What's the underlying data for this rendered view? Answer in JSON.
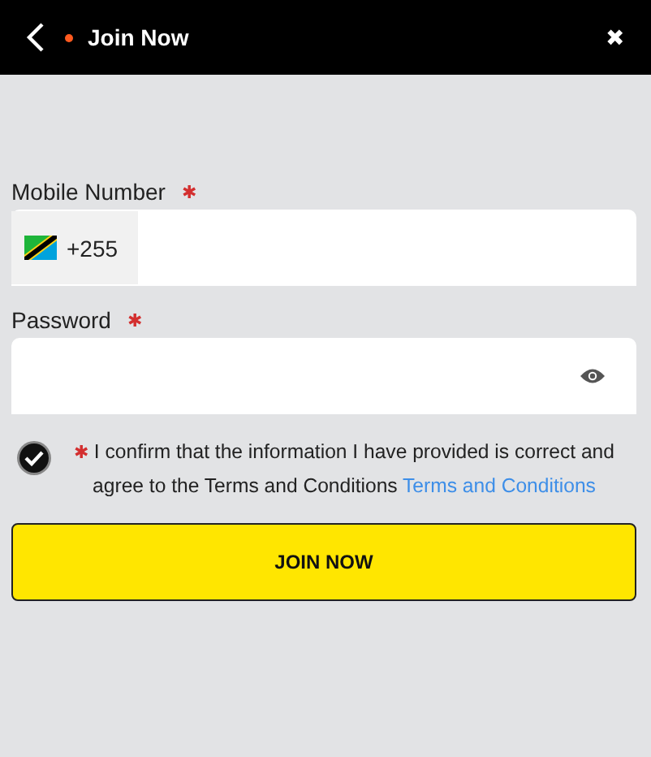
{
  "header": {
    "title": "Join Now",
    "close": "✖"
  },
  "mobile": {
    "label": "Mobile Number",
    "required_mark": "✱",
    "country_code": "+255"
  },
  "password": {
    "label": "Password",
    "required_mark": "✱"
  },
  "consent": {
    "checked": true,
    "required_mark": "✱",
    "text": "I confirm that the information I have provided is correct and agree to the Terms and Conditions",
    "link": "Terms and Conditions"
  },
  "submit": "JOIN NOW"
}
